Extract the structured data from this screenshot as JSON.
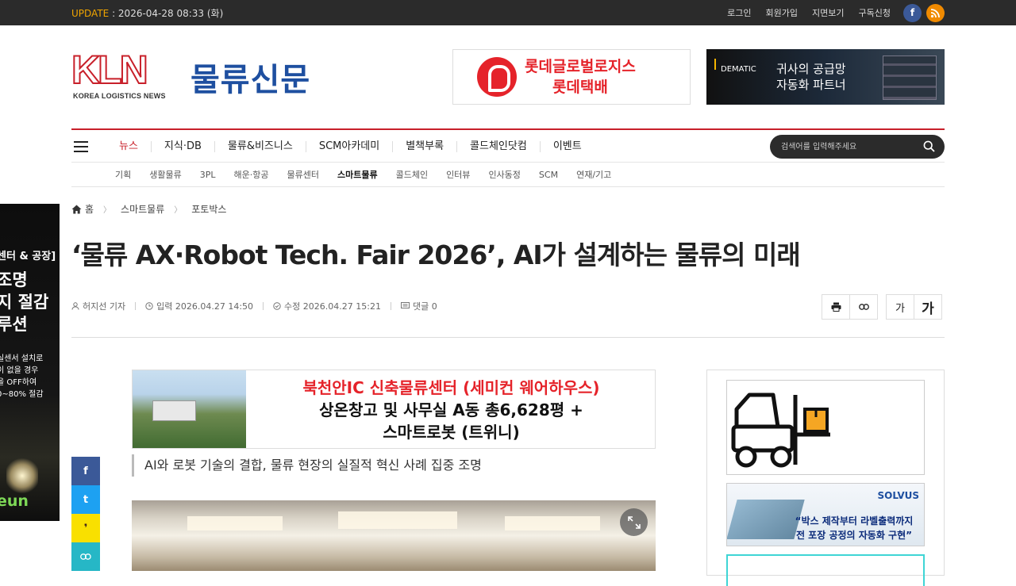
{
  "topbar": {
    "update_label": "UPDATE",
    "update_value": " : 2026-04-28 08:33 (화)",
    "links": [
      "로그인",
      "회원가입",
      "지면보기",
      "구독신청"
    ],
    "facebook": "f",
    "rss_icon": "rss-icon"
  },
  "logo": {
    "mark": "KLN",
    "sub": "KOREA LOGISTICS NEWS",
    "name": "물류신문"
  },
  "ads": {
    "lotte_line1": "롯데글로벌로지스",
    "lotte_line2": "롯데택배",
    "dematic_brand": "DEMATIC",
    "dematic_line1": "귀사의 공급망",
    "dematic_line2": "자동화 파트너"
  },
  "nav": {
    "items": [
      "뉴스",
      "지식·DB",
      "물류&비즈니스",
      "SCM아카데미",
      "별책부록",
      "콜드체인닷컴",
      "이벤트"
    ],
    "search_placeholder": "검색어를 입력해주세요",
    "sub_items": [
      "기획",
      "생활물류",
      "3PL",
      "해운·항공",
      "물류센터",
      "스마트물류",
      "콜드체인",
      "인터뷰",
      "인사동정",
      "SCM",
      "연재/기고"
    ],
    "active_sub": "스마트물류"
  },
  "breadcrumb": [
    "홈",
    "스마트물류",
    "포토박스"
  ],
  "article": {
    "title": "‘물류 AX·Robot Tech. Fair 2026’, AI가 설계하는 물류의 미래",
    "author": "허지선 기자",
    "published": "입력 2026.04.27 14:50",
    "modified": "수정 2026.04.27 15:21",
    "comments": "댓글 0",
    "font_small": "가",
    "font_large": "가",
    "lead": "AI와 로봇 기술의 결합, 물류 현장의 실질적 혁신 사례 집중 조명"
  },
  "main_ad": {
    "line1": "북천안IC 신축물류센터 (세미컨 웨어하우스)",
    "line2": "상온창고 및 사무실 A동 총6,628평 +",
    "line3": "스마트로봇 (트위니)"
  },
  "left_ad": {
    "l1": "센터 & 공장]",
    "l2": "조명",
    "l3": "지 절감",
    "l4": "루션",
    "l5": "실센서 설치로",
    "l6": "이 없을 경우",
    "l7": "을 OFF하여",
    "l8": "0~80% 절감",
    "brand": "eun"
  },
  "share": [
    "f",
    "t",
    "❜",
    "link-icon"
  ],
  "side_ads": {
    "solvus_brand": "SOLVUS",
    "solvus_line1": "“박스 제작부터 라벨출력까지",
    "solvus_line2": "전 포장 공정의 자동화 구현”"
  },
  "colors": {
    "brand_red": "#c8202a",
    "dark": "#2b2b2b",
    "logo_blue": "#1e4fa0"
  }
}
